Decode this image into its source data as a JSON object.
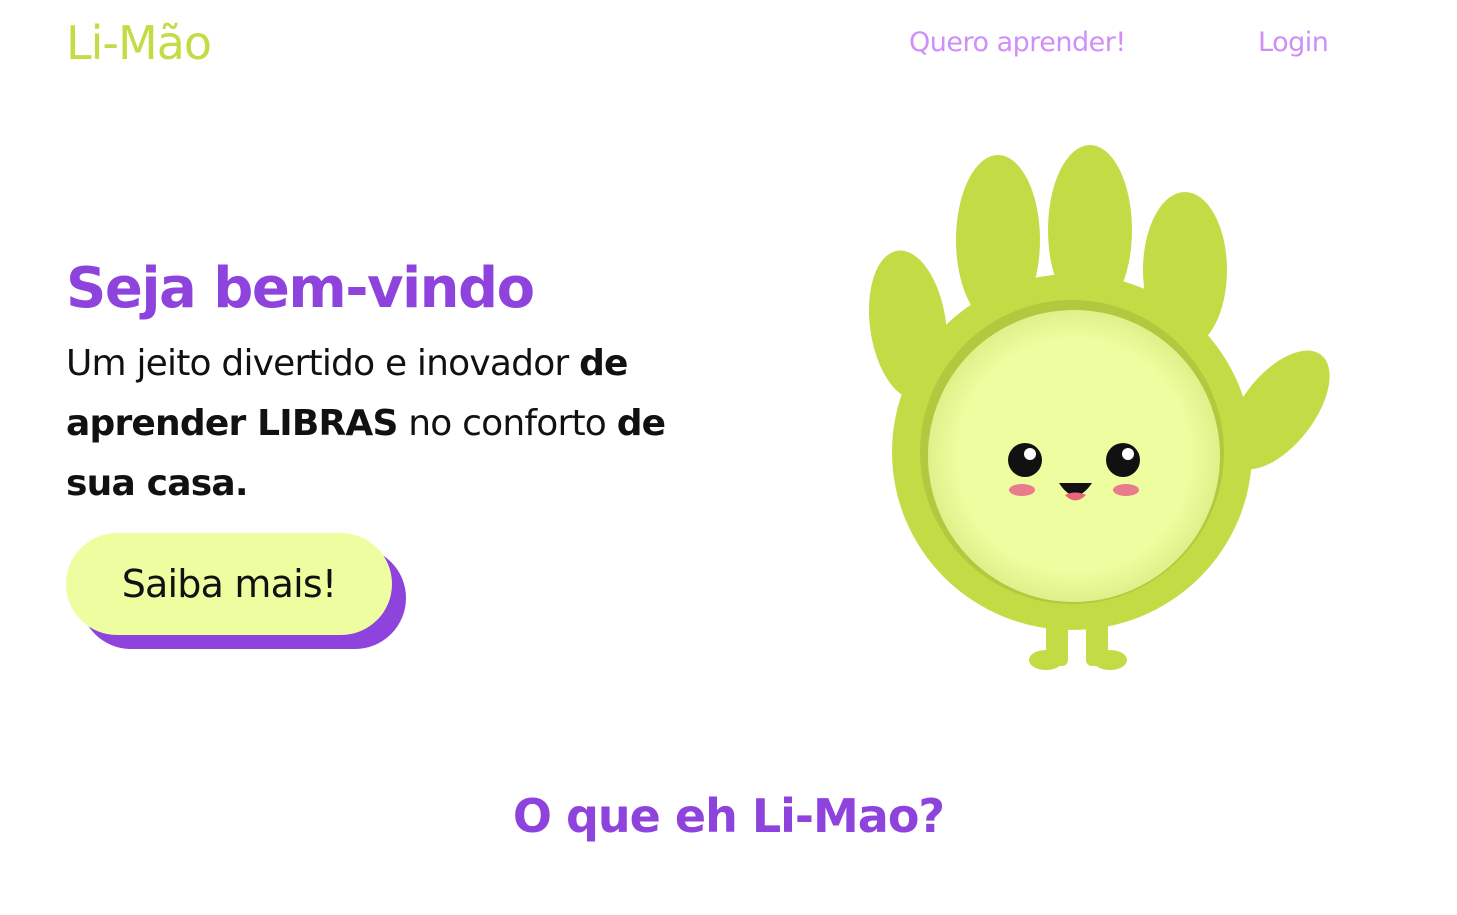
{
  "header": {
    "logo": "Li-Mão",
    "nav": {
      "learn": "Quero aprender!",
      "login": "Login"
    }
  },
  "hero": {
    "title": "Seja bem-vindo",
    "text_parts": {
      "p1": "Um jeito divertido e inovador ",
      "p2": "de aprender LIBRAS",
      "p3": " no conforto ",
      "p4": "de sua casa."
    },
    "cta_label": "Saiba mais!"
  },
  "mascot": {
    "icon": "smiling-hand-mascot-icon"
  },
  "section": {
    "title": "O que eh Li-Mao?"
  },
  "colors": {
    "brand_green": "#c3dc45",
    "light_green": "#eefd9f",
    "purple": "#8e43dd",
    "nav_purple": "#cf8ff7"
  }
}
